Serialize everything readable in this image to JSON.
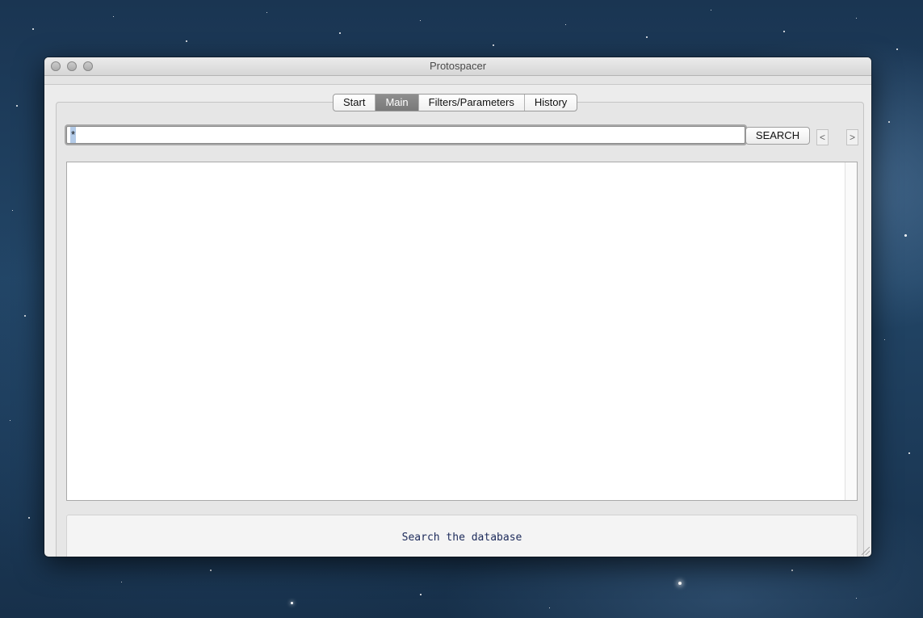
{
  "window": {
    "title": "Protospacer"
  },
  "tabs": [
    {
      "label": "Start",
      "active": false
    },
    {
      "label": "Main",
      "active": true
    },
    {
      "label": "Filters/Parameters",
      "active": false
    },
    {
      "label": "History",
      "active": false
    }
  ],
  "search": {
    "value": "*",
    "button_label": "SEARCH"
  },
  "navigation": {
    "prev_label": "<",
    "next_label": ">"
  },
  "status": {
    "text": "Search the database"
  },
  "icons": {
    "close": "close-icon",
    "minimize": "minimize-icon",
    "zoom": "zoom-icon",
    "resize": "resize-grip-icon"
  },
  "colors": {
    "active_tab": "#858585",
    "status_text": "#1c2a5a",
    "selection": "#b3cbe8"
  }
}
